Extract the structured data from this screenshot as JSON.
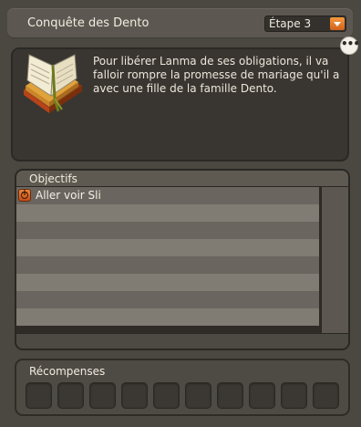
{
  "header": {
    "title": "Conquête des Dento",
    "step_select": {
      "value": "Étape 3"
    }
  },
  "description": {
    "text": "Pour libérer Lanma de ses obligations, il va falloir rompre la promesse de mariage qu'il a avec une fille de la famille Dento."
  },
  "objectives": {
    "title": "Objectifs",
    "items": [
      {
        "label": "Aller voir Sli",
        "icon": "add-icon"
      }
    ]
  },
  "rewards": {
    "title": "Récompenses",
    "slot_count": 10
  },
  "icons": {
    "quest": "book-icon",
    "more": "more-options-icon",
    "dropdown": "chevron-down-icon"
  },
  "colors": {
    "background": "#4b4741",
    "panel_dark": "#393631",
    "accent_orange": "#e7782a"
  }
}
